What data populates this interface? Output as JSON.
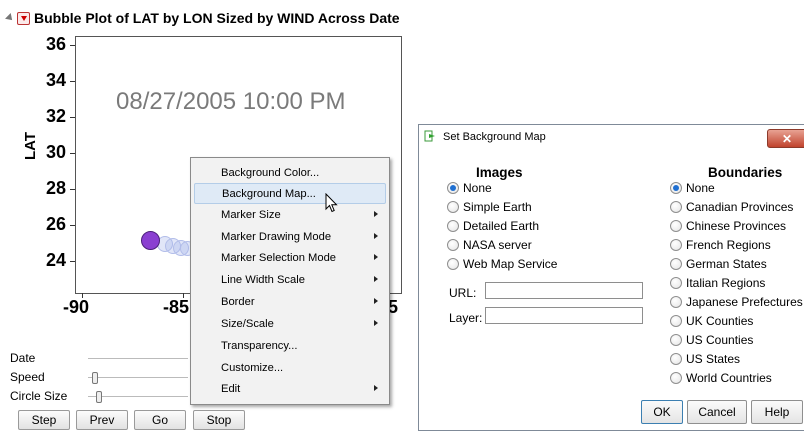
{
  "report": {
    "title": "Bubble Plot of LAT by LON Sized by WIND Across Date"
  },
  "plot": {
    "y_axis_label": "LAT",
    "y_ticks": [
      "36",
      "34",
      "32",
      "30",
      "28",
      "26",
      "24"
    ],
    "x_ticks": [
      "-90",
      "-85",
      "5"
    ],
    "date_overlay": "08/27/2005 10:00 PM",
    "bubble_color_main": "#8a3fd1",
    "bubble_color_trail": "#aab6ec"
  },
  "controls": {
    "date_label": "Date",
    "speed_label": "Speed",
    "circle_size_label": "Circle Size",
    "step_label": "Step",
    "prev_label": "Prev",
    "go_label": "Go",
    "stop_label": "Stop"
  },
  "context_menu": {
    "items": [
      {
        "label": "Background Color...",
        "has_submenu": false
      },
      {
        "label": "Background Map...",
        "has_submenu": false,
        "highlighted": true
      },
      {
        "label": "Marker Size",
        "has_submenu": true
      },
      {
        "label": "Marker Drawing Mode",
        "has_submenu": true
      },
      {
        "label": "Marker Selection Mode",
        "has_submenu": true
      },
      {
        "label": "Line Width Scale",
        "has_submenu": true
      },
      {
        "label": "Border",
        "has_submenu": true
      },
      {
        "label": "Size/Scale",
        "has_submenu": true
      },
      {
        "label": "Transparency...",
        "has_submenu": false
      },
      {
        "label": "Customize...",
        "has_submenu": false
      },
      {
        "label": "Edit",
        "has_submenu": true
      }
    ]
  },
  "dialog": {
    "title": "Set Background Map",
    "close_icon": "close-icon",
    "images_heading": "Images",
    "images_options": [
      "None",
      "Simple Earth",
      "Detailed Earth",
      "NASA server",
      "Web Map Service"
    ],
    "images_selected": "None",
    "url_label": "URL:",
    "url_value": "",
    "layer_label": "Layer:",
    "layer_value": "",
    "boundaries_heading": "Boundaries",
    "boundaries_options": [
      "None",
      "Canadian Provinces",
      "Chinese Provinces",
      "French Regions",
      "German States",
      "Italian Regions",
      "Japanese Prefectures",
      "UK Counties",
      "US Counties",
      "US States",
      "World Countries"
    ],
    "boundaries_selected": "None",
    "ok_label": "OK",
    "cancel_label": "Cancel",
    "help_label": "Help"
  }
}
